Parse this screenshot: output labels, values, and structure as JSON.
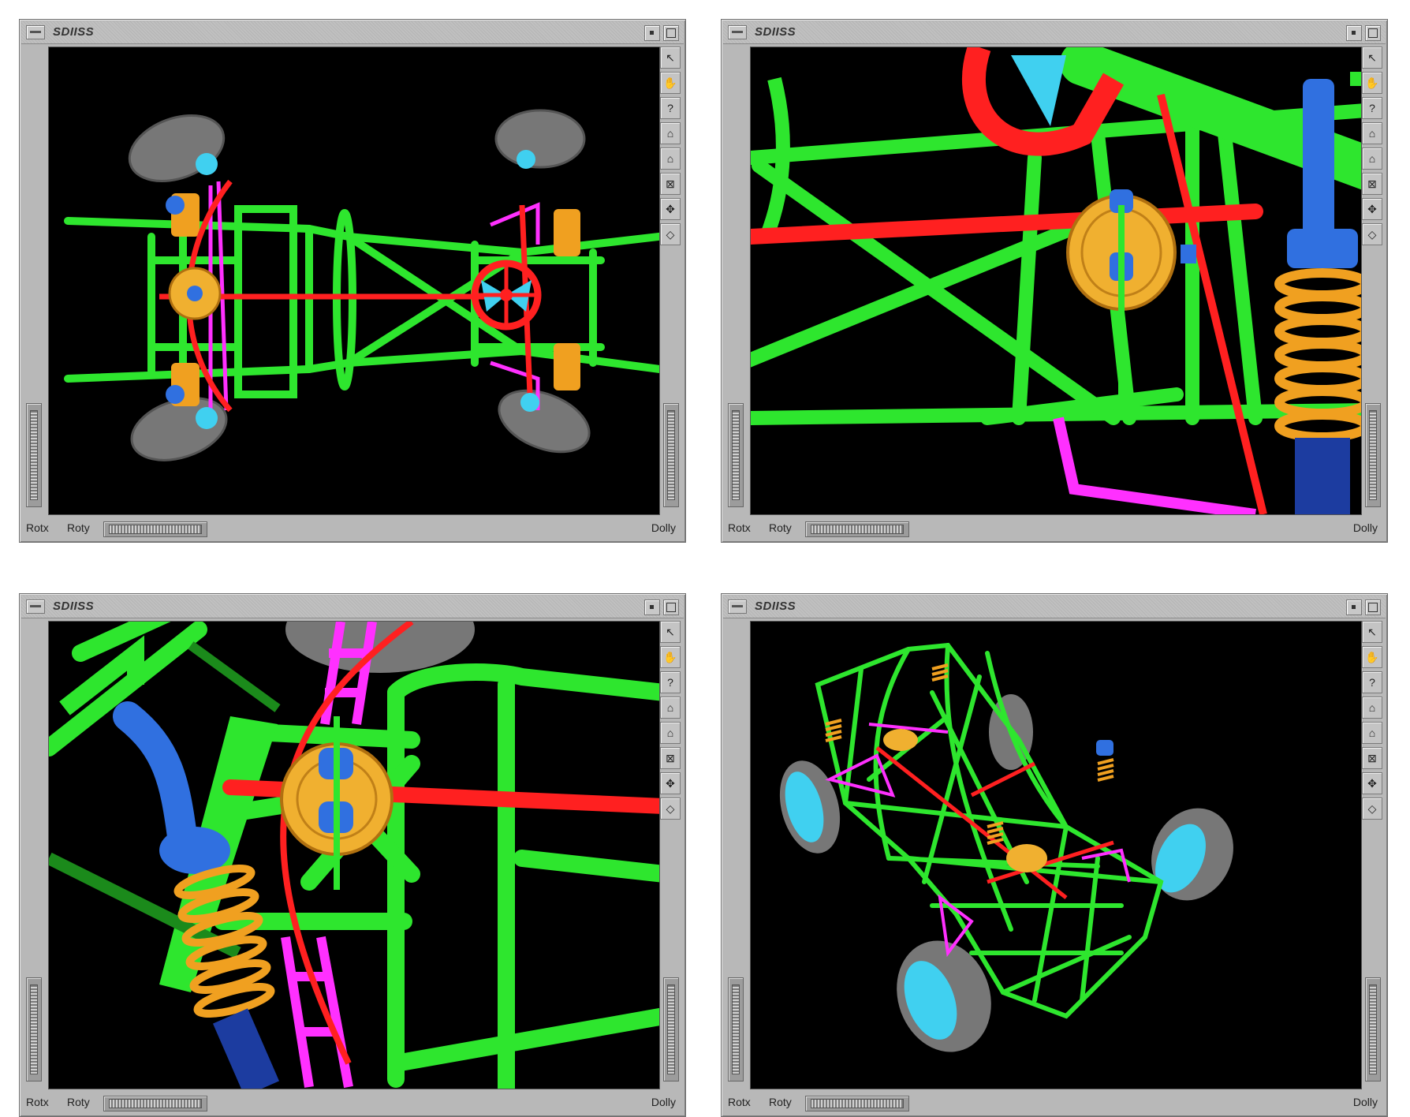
{
  "windows": [
    {
      "title": "SDIISS",
      "labels": {
        "rotx": "Rotx",
        "roty": "Roty",
        "dolly": "Dolly"
      }
    },
    {
      "title": "SDIISS",
      "labels": {
        "rotx": "Rotx",
        "roty": "Roty",
        "dolly": "Dolly"
      }
    },
    {
      "title": "SDIISS",
      "labels": {
        "rotx": "Rotx",
        "roty": "Roty",
        "dolly": "Dolly"
      }
    },
    {
      "title": "SDIISS",
      "labels": {
        "rotx": "Rotx",
        "roty": "Roty",
        "dolly": "Dolly"
      }
    }
  ],
  "toolbar_icons": [
    {
      "name": "pointer-icon",
      "glyph": "↖"
    },
    {
      "name": "hand-icon",
      "glyph": "✋"
    },
    {
      "name": "help-icon",
      "glyph": "?"
    },
    {
      "name": "home-icon",
      "glyph": "⌂"
    },
    {
      "name": "set-home-icon",
      "glyph": "⌂"
    },
    {
      "name": "view-all-icon",
      "glyph": "⊠"
    },
    {
      "name": "seek-icon",
      "glyph": "✥"
    },
    {
      "name": "perspective-icon",
      "glyph": "◇"
    }
  ],
  "colors": {
    "frame": "#2ee62e",
    "steering": "#ff2020",
    "suspension_arm": "#ff30ff",
    "spring": "#f0a020",
    "shock": "#3070e0",
    "tire": "#7a7a7a",
    "hub": "#40d0f0",
    "brake_disc": "#f0b030",
    "background": "#000000"
  }
}
